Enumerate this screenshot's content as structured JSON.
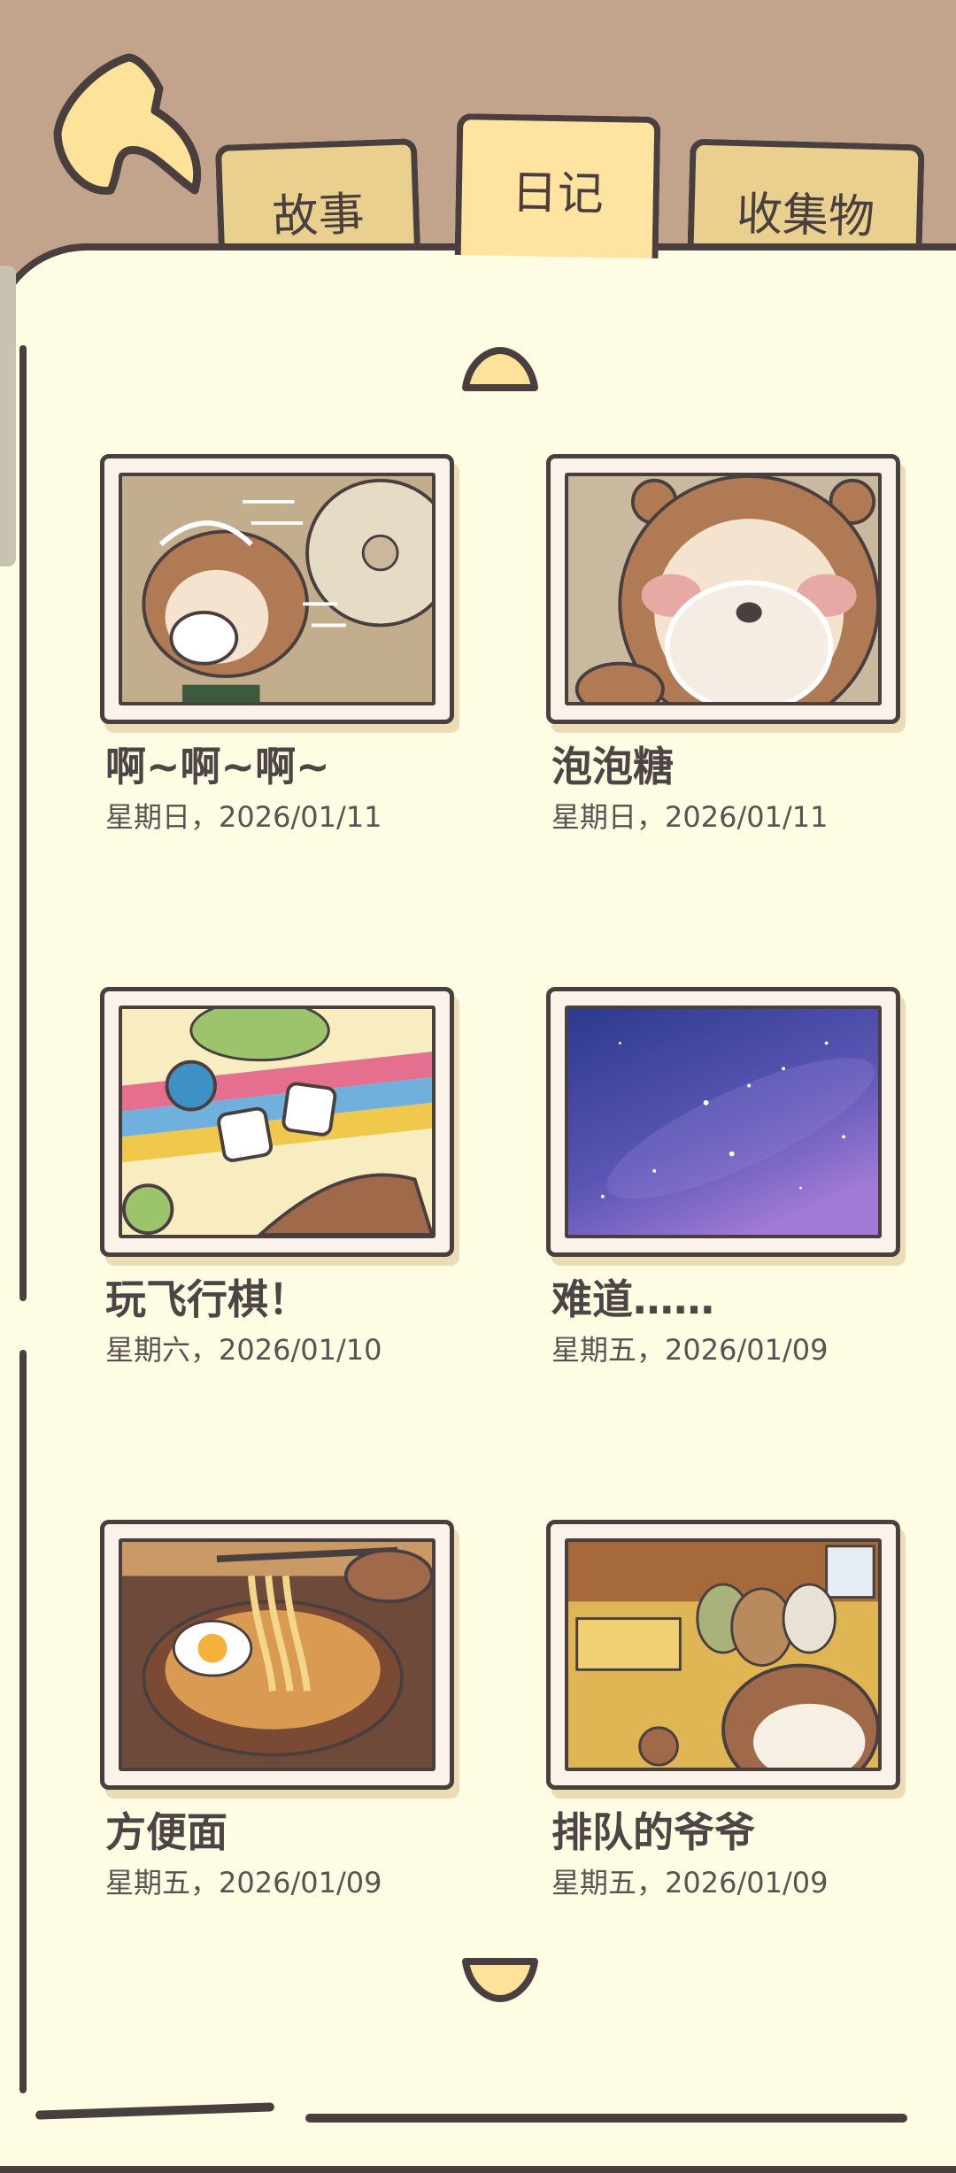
{
  "tabs": {
    "story": "故事",
    "diary": "日记",
    "collection": "收集物"
  },
  "entries": [
    {
      "title": "啊~啊~啊~",
      "date": "星期日，2026/01/11"
    },
    {
      "title": "泡泡糖",
      "date": "星期日，2026/01/11"
    },
    {
      "title": "玩飞行棋！",
      "date": "星期六，2026/01/10"
    },
    {
      "title": "难道……",
      "date": "星期五，2026/01/09"
    },
    {
      "title": "方便面",
      "date": "星期五，2026/01/09"
    },
    {
      "title": "排队的爷爷",
      "date": "星期五，2026/01/09"
    }
  ],
  "icons": {
    "back": "back-arrow-icon",
    "scroll_up": "chevron-up-icon",
    "scroll_down": "chevron-down-icon"
  },
  "colors": {
    "background": "#c2a38b",
    "page": "#fefce3",
    "outline": "#4a3f3f",
    "tab_active": "#ffe3a1",
    "tab_inactive": "#e9d08e"
  }
}
